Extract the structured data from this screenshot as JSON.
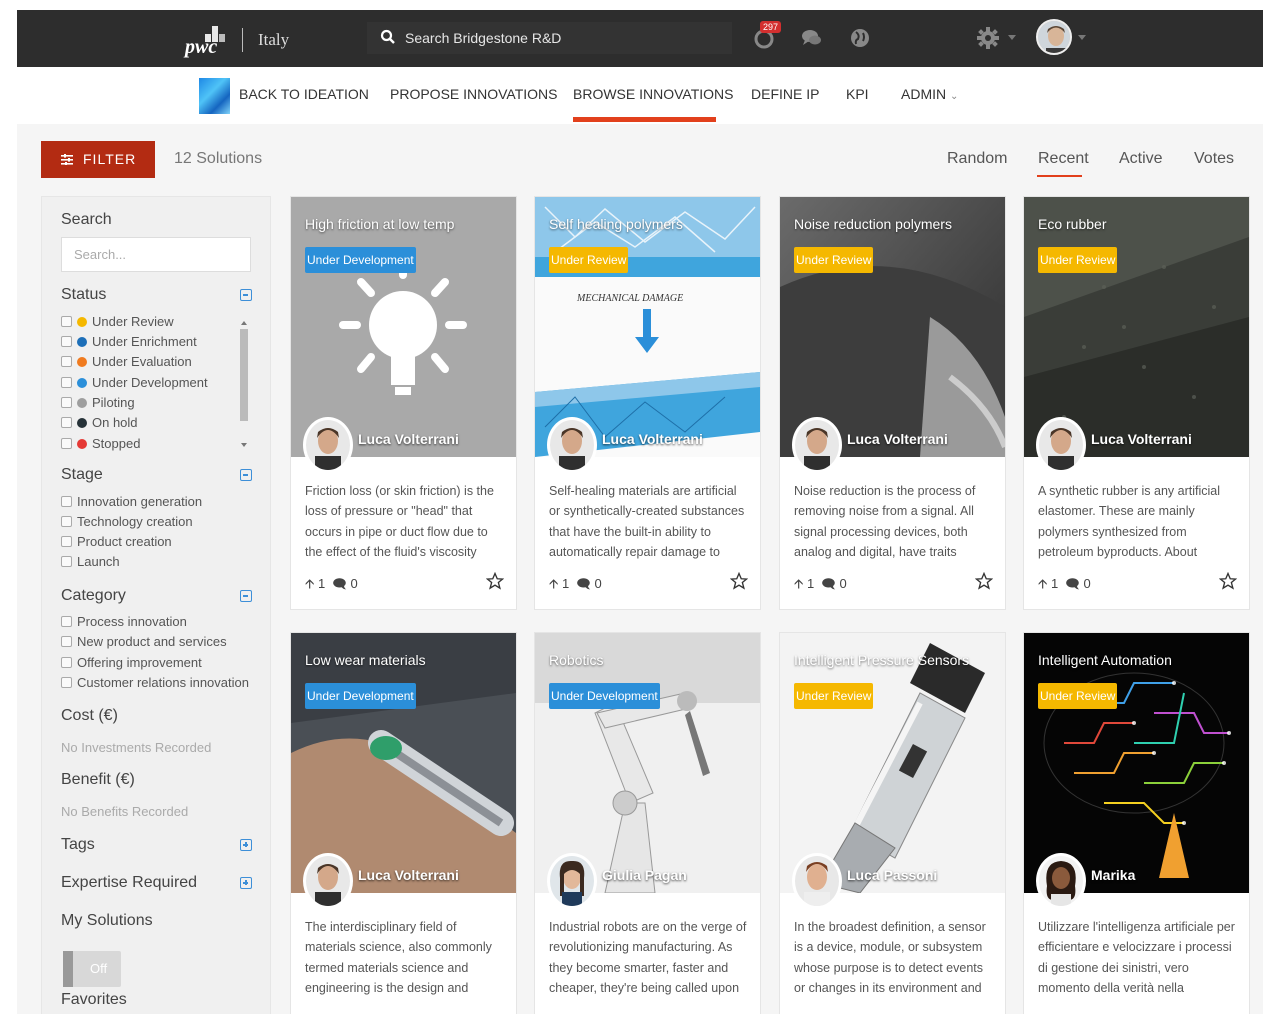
{
  "header": {
    "logo_text": "pwc",
    "country": "Italy",
    "search_placeholder": "Search Bridgestone R&D",
    "notification_count": "297",
    "icons": [
      "notifications-icon",
      "chat-icon",
      "globe-icon",
      "gear-icon",
      "user-avatar"
    ]
  },
  "nav": {
    "items": [
      "BACK TO IDEATION",
      "PROPOSE INNOVATIONS",
      "BROWSE INNOVATIONS",
      "DEFINE IP",
      "KPI",
      "ADMIN"
    ],
    "active": "BROWSE INNOVATIONS"
  },
  "toolbar": {
    "filter_label": "FILTER",
    "solutions_count": "12 Solutions",
    "sort": [
      "Random",
      "Recent",
      "Active",
      "Votes"
    ],
    "sort_active": "Recent"
  },
  "sidebar": {
    "search_heading": "Search",
    "search_placeholder": "Search...",
    "status_heading": "Status",
    "status_items": [
      {
        "label": "Under Review",
        "color": "#f5b800"
      },
      {
        "label": "Under Enrichment",
        "color": "#1d6fb8"
      },
      {
        "label": "Under Evaluation",
        "color": "#f07b1f"
      },
      {
        "label": "Under Development",
        "color": "#2b8fd9"
      },
      {
        "label": "Piloting",
        "color": "#9e9e9e"
      },
      {
        "label": "On hold",
        "color": "#263238"
      },
      {
        "label": "Stopped",
        "color": "#e53935"
      }
    ],
    "stage_heading": "Stage",
    "stage_items": [
      "Innovation generation",
      "Technology creation",
      "Product creation",
      "Launch"
    ],
    "category_heading": "Category",
    "category_items": [
      "Process innovation",
      "New product and services",
      "Offering improvement",
      "Customer relations innovation"
    ],
    "cost_heading": "Cost (€)",
    "cost_note": "No Investments Recorded",
    "benefit_heading": "Benefit (€)",
    "benefit_note": "No Benefits Recorded",
    "tags_heading": "Tags",
    "expertise_heading": "Expertise Required",
    "my_solutions_heading": "My Solutions",
    "my_solutions_toggle": "Off",
    "favorites_heading": "Favorites"
  },
  "cards": [
    {
      "title": "High friction at low temp",
      "status": "Under Development",
      "author": "Luca Volterrani",
      "desc": "Friction loss (or skin friction) is the loss of pressure or \"head\" that occurs in pipe or duct flow due to the effect of the fluid's viscosity near",
      "votes": "1",
      "comments": "0"
    },
    {
      "title": "Self healing polymers",
      "status": "Under Review",
      "author": "Luca Volterrani",
      "desc": "Self-healing materials are artificial or synthetically-created substances that have the built-in ability to automatically repair damage to",
      "votes": "1",
      "comments": "0",
      "img_text": "MECHANICAL DAMAGE"
    },
    {
      "title": "Noise reduction polymers",
      "status": "Under Review",
      "author": "Luca Volterrani",
      "desc": "Noise reduction is the process of removing noise from a signal. All signal processing devices, both analog and digital, have traits",
      "votes": "1",
      "comments": "0"
    },
    {
      "title": "Eco rubber",
      "status": "Under Review",
      "author": "Luca Volterrani",
      "desc": "A synthetic rubber is any artificial elastomer. These are mainly polymers synthesized from petroleum byproducts. About",
      "votes": "1",
      "comments": "0"
    },
    {
      "title": "Low wear materials",
      "status": "Under Development",
      "author": "Luca Volterrani",
      "desc": "The interdisciplinary field of materials science, also commonly termed materials science and engineering is the design and",
      "votes": "",
      "comments": ""
    },
    {
      "title": "Robotics",
      "status": "Under Development",
      "author": "Giulia Pagan",
      "desc": "Industrial robots are on the verge of revolutionizing manufacturing. As they become smarter, faster and cheaper, they're being called upon",
      "votes": "",
      "comments": ""
    },
    {
      "title": "Intelligent Pressure Sensors",
      "status": "Under Review",
      "author": "Luca Passoni",
      "desc": "In the broadest definition, a sensor is a device, module, or subsystem whose purpose is to detect events or changes in its environment and",
      "votes": "",
      "comments": ""
    },
    {
      "title": "Intelligent Automation",
      "status": "Under Review",
      "author": "Marika",
      "desc": "Utilizzare l'intelligenza artificiale per efficientare e velocizzare i processi di gestione dei sinistri, vero momento della verità nella",
      "votes": "",
      "comments": ""
    }
  ]
}
